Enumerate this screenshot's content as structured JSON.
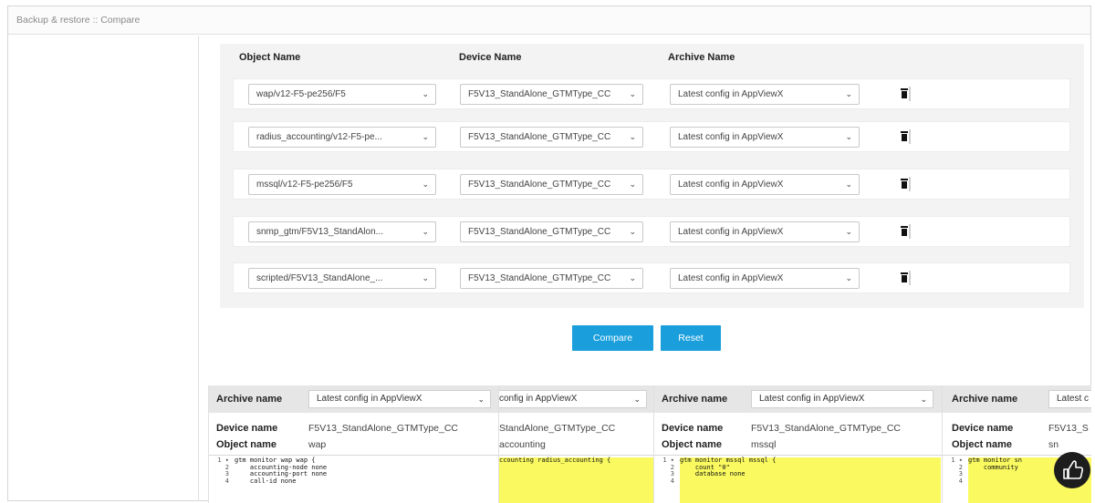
{
  "window": {
    "title": "Backup & restore :: Compare"
  },
  "headers": {
    "object": "Object Name",
    "device": "Device Name",
    "archive": "Archive Name"
  },
  "rows": [
    {
      "object": "wap/v12-F5-pe256/F5",
      "device": "F5V13_StandAlone_GTMType_CC",
      "archive": "Latest config in AppViewX"
    },
    {
      "object": "radius_accounting/v12-F5-pe...",
      "device": "F5V13_StandAlone_GTMType_CC",
      "archive": "Latest config in AppViewX"
    },
    {
      "object": "mssql/v12-F5-pe256/F5",
      "device": "F5V13_StandAlone_GTMType_CC",
      "archive": "Latest config in AppViewX"
    },
    {
      "object": "snmp_gtm/F5V13_StandAlon...",
      "device": "F5V13_StandAlone_GTMType_CC",
      "archive": "Latest config in AppViewX"
    },
    {
      "object": "scripted/F5V13_StandAlone_...",
      "device": "F5V13_StandAlone_GTMType_CC",
      "archive": "Latest config in AppViewX"
    }
  ],
  "icons": {
    "caret": "chevron-down-icon",
    "delete": "trash-icon",
    "feedback": "thumbs-up-icon"
  },
  "buttons": {
    "compare": "Compare",
    "reset": "Reset"
  },
  "colors": {
    "primary_button": "#1a9fdc",
    "diff_highlight": "#fafa60"
  },
  "compare_labels": {
    "archive": "Archive name",
    "device": "Device name",
    "object": "Object name"
  },
  "compare_panels": [
    {
      "archive": "Latest config in AppViewX",
      "device": "F5V13_StandAlone_GTMType_CC",
      "object": "wap",
      "gutter": "1 ▾\n2\n3\n4",
      "code": "gtm monitor wap wap {\n    accounting-node none\n    accounting-port none\n    call-id none"
    },
    {
      "archive": "config in AppViewX",
      "device": "StandAlone_GTMType_CC",
      "object": "accounting",
      "code": "ccounting radius_accounting {"
    },
    {
      "archive": "Latest config in AppViewX",
      "device": "F5V13_StandAlone_GTMType_CC",
      "object": "mssql",
      "gutter": "1 ▾\n2\n3\n4",
      "code": "gtm monitor mssql mssql {\n    count \"0\"\n    database none"
    },
    {
      "archive": "Latest c",
      "device": "F5V13_S",
      "object": "sn",
      "gutter": "1 ▾\n2\n3\n4",
      "code": "gtm monitor sn\n    community"
    }
  ]
}
